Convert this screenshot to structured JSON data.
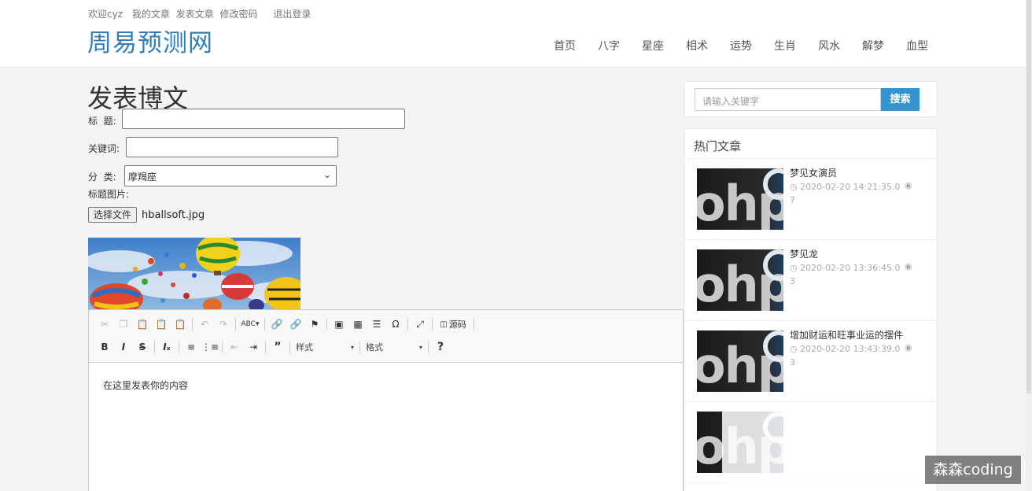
{
  "topbar": {
    "welcome": "欢迎cyz",
    "my_articles": "我的文章",
    "post_article": "发表文章",
    "change_password": "修改密码",
    "logout": "退出登录"
  },
  "site": {
    "logo": "周易预测网"
  },
  "nav": [
    "首页",
    "八字",
    "星座",
    "相术",
    "运势",
    "生肖",
    "风水",
    "解梦",
    "血型"
  ],
  "form": {
    "page_title": "发表博文",
    "title_label": "标  题:",
    "title_value": "",
    "keywords_label": "关键词:",
    "keywords_value": "",
    "category_label": "分  类:",
    "category_selected": "摩羯座",
    "image_label": "标题图片:",
    "file_button": "选择文件",
    "file_name": "hballsoft.jpg"
  },
  "editor": {
    "source_label": "源码",
    "style_combo": "样式",
    "format_combo": "格式",
    "help": "?",
    "content": "在这里发表你的内容"
  },
  "sidebar": {
    "search_placeholder": "请输入关键字",
    "search_button": "搜索",
    "hot_title": "热门文章",
    "articles": [
      {
        "title": "梦见女演员",
        "time": "2020-02-20 14:21:35.0",
        "views": "7"
      },
      {
        "title": "梦见龙",
        "time": "2020-02-20 13:36:45.0",
        "views": "3"
      },
      {
        "title": "增加财运和旺事业运的摆件",
        "time": "2020-02-20 13:43:39.0",
        "views": "3"
      }
    ]
  },
  "watermark": "森森coding",
  "colors": {
    "brand": "#2f7fc0",
    "search_button": "#3593d0"
  }
}
